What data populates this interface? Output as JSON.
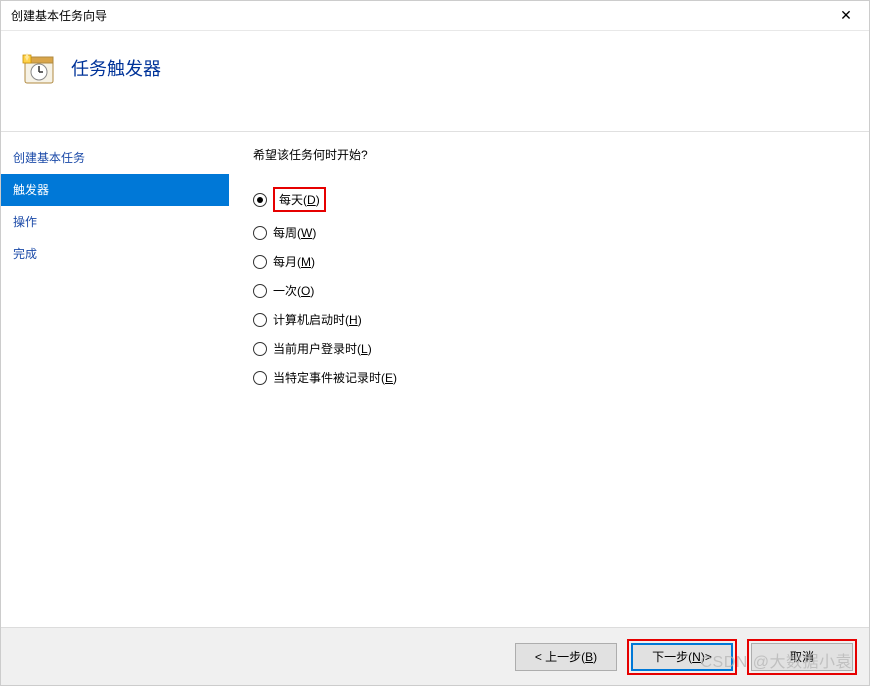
{
  "window": {
    "title": "创建基本任务向导"
  },
  "header": {
    "title": "任务触发器"
  },
  "sidebar": {
    "items": [
      {
        "label": "创建基本任务",
        "selected": false
      },
      {
        "label": "触发器",
        "selected": true
      },
      {
        "label": "操作",
        "selected": false
      },
      {
        "label": "完成",
        "selected": false
      }
    ]
  },
  "content": {
    "prompt": "希望该任务何时开始?",
    "options": [
      {
        "label": "每天",
        "mnemonic": "D",
        "checked": true,
        "highlight": true
      },
      {
        "label": "每周",
        "mnemonic": "W",
        "checked": false,
        "highlight": false
      },
      {
        "label": "每月",
        "mnemonic": "M",
        "checked": false,
        "highlight": false
      },
      {
        "label": "一次",
        "mnemonic": "O",
        "checked": false,
        "highlight": false
      },
      {
        "label": "计算机启动时",
        "mnemonic": "H",
        "checked": false,
        "highlight": false
      },
      {
        "label": "当前用户登录时",
        "mnemonic": "L",
        "checked": false,
        "highlight": false
      },
      {
        "label": "当特定事件被记录时",
        "mnemonic": "E",
        "checked": false,
        "highlight": false
      }
    ]
  },
  "footer": {
    "back": {
      "label_prefix": "< 上一步",
      "mnemonic": "B"
    },
    "next": {
      "label_prefix": "下一步",
      "mnemonic": "N",
      "label_suffix": " >",
      "highlight": true
    },
    "cancel": {
      "label": "取消",
      "highlight": true
    }
  },
  "watermark": "CSDN @大数据小袁"
}
